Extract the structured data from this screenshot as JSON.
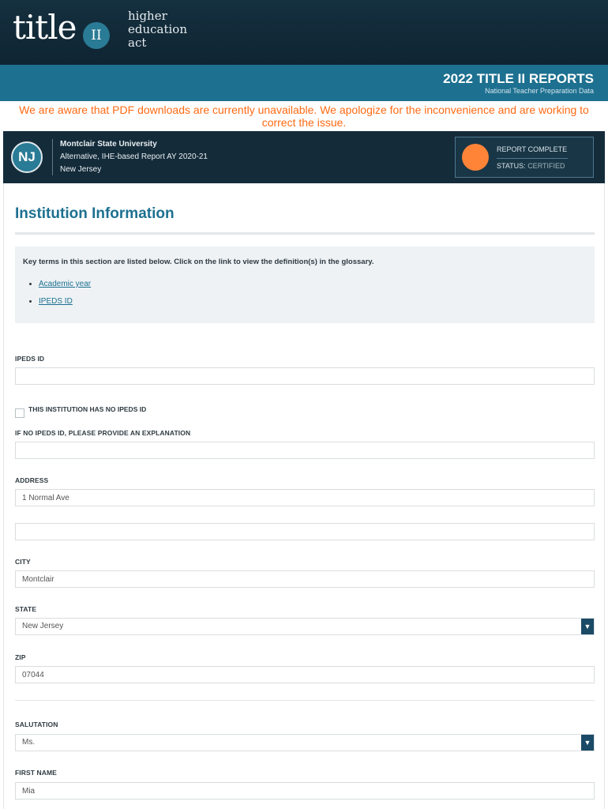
{
  "header": {
    "logo_title": "title",
    "logo_roman": "II",
    "logo_tagline": [
      "higher",
      "education",
      "act"
    ],
    "report_title": "2022 TITLE II REPORTS",
    "report_subtitle": "National Teacher Preparation Data"
  },
  "alert": {
    "message": "We are aware that PDF downloads are currently unavailable. We apologize for the inconvenience and are working to correct the issue."
  },
  "institution": {
    "state_abbr": "NJ",
    "name": "Montclair State University",
    "report_type": "Alternative, IHE-based Report AY 2020-21",
    "state": "New Jersey",
    "status_title": "REPORT COMPLETE",
    "status_label": "STATUS:",
    "status_value": "CERTIFIED"
  },
  "section": {
    "title": "Institution Information",
    "glossary_intro": "Key terms in this section are listed below. Click on the link to view the definition(s) in the glossary.",
    "glossary_links": [
      "Academic year",
      "IPEDS ID"
    ]
  },
  "form": {
    "ipeds_label": "IPEDS ID",
    "ipeds_value": "",
    "no_ipeds_label": "THIS INSTITUTION HAS NO IPEDS ID",
    "explanation_label": "IF NO IPEDS ID, PLEASE PROVIDE AN EXPLANATION",
    "explanation_value": "",
    "address_label": "ADDRESS",
    "address_line1": "1 Normal Ave",
    "address_line2": "",
    "city_label": "CITY",
    "city_value": "Montclair",
    "state_label": "STATE",
    "state_value": "New Jersey",
    "zip_label": "ZIP",
    "zip_value": "07044",
    "salutation_label": "SALUTATION",
    "salutation_value": "Ms.",
    "first_name_label": "FIRST NAME",
    "first_name_value": "Mia"
  },
  "colors": {
    "header_dark": "#15303f",
    "band_teal": "#1d7090",
    "alert_orange": "#ff6a13",
    "status_orange": "#ff8438"
  }
}
